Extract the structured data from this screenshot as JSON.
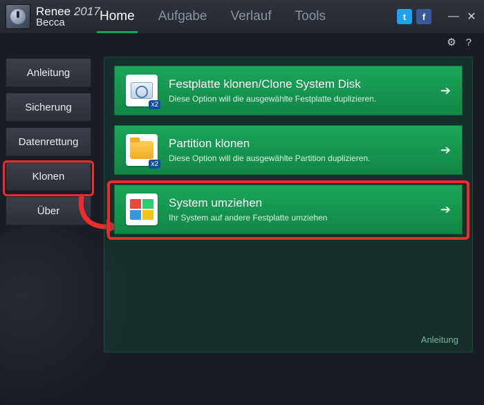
{
  "brand": {
    "name": "Renee",
    "year": "2017",
    "sub": "Becca"
  },
  "topnav": {
    "home": "Home",
    "aufgabe": "Aufgabe",
    "verlauf": "Verlauf",
    "tools": "Tools"
  },
  "window": {
    "settings_icon": "gear-icon",
    "help_icon": "help-icon"
  },
  "sidebar": {
    "items": [
      {
        "label": "Anleitung"
      },
      {
        "label": "Sicherung"
      },
      {
        "label": "Datenrettung"
      },
      {
        "label": "Klonen"
      },
      {
        "label": "Über"
      }
    ]
  },
  "cards": [
    {
      "title": "Festplatte klonen/Clone System Disk",
      "desc": "Diese Option will die ausgewählte Festplatte duplizieren.",
      "iconBadge": "x2"
    },
    {
      "title": "Partition klonen",
      "desc": "Diese Option will die ausgewählte Partition duplizieren.",
      "iconBadge": "x2"
    },
    {
      "title": "System umziehen",
      "desc": "Ihr System auf andere Festplatte umziehen",
      "iconBadge": ""
    }
  ],
  "footer": {
    "anleitung": "Anleitung"
  },
  "colors": {
    "accent": "#189451",
    "highlight": "#ef2b2b"
  }
}
